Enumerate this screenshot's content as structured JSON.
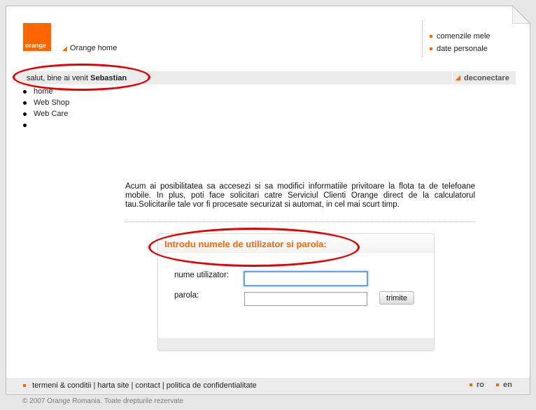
{
  "header": {
    "logo_text": "orange",
    "home_link": "Orange home",
    "account_links": [
      "comenzile mele",
      "date personale"
    ]
  },
  "greeting_bar": {
    "greeting_prefix": "salut, bine ai venit",
    "user_name": "Sebastian",
    "logout_label": "deconectare"
  },
  "nav": {
    "items": [
      "home",
      "Web Shop",
      "Web Care",
      ""
    ]
  },
  "intro_text": "Acum ai posibilitatea sa accesezi si sa modifici informatiile privitoare la flota ta de telefoane mobile. In plus, poti face solicitari catre Serviciul Clienti Orange direct de la calculatorul tau.Solicitarile tale vor fi procesate securizat si automat, in cel mai scurt timp.",
  "login": {
    "title": "Introdu numele de utilizator si parola:",
    "username_label": "nume utilizator:",
    "username_value": "",
    "password_label": "parola:",
    "password_value": "",
    "submit_label": "trimite"
  },
  "footer": {
    "links": [
      "termeni & conditii",
      "harta site",
      "contact",
      "politica de confidentialitate"
    ],
    "languages": [
      "ro",
      "en"
    ],
    "copyright": "© 2007 Orange Romania. Toate drepturile rezervate"
  },
  "colors": {
    "brand_orange": "#ff6600",
    "annotation_red": "#e20000",
    "bar_gray": "#ebebeb"
  },
  "icons": [
    "orange-arrow-icon",
    "orange-square-bullet-icon",
    "page-fold-icon"
  ]
}
